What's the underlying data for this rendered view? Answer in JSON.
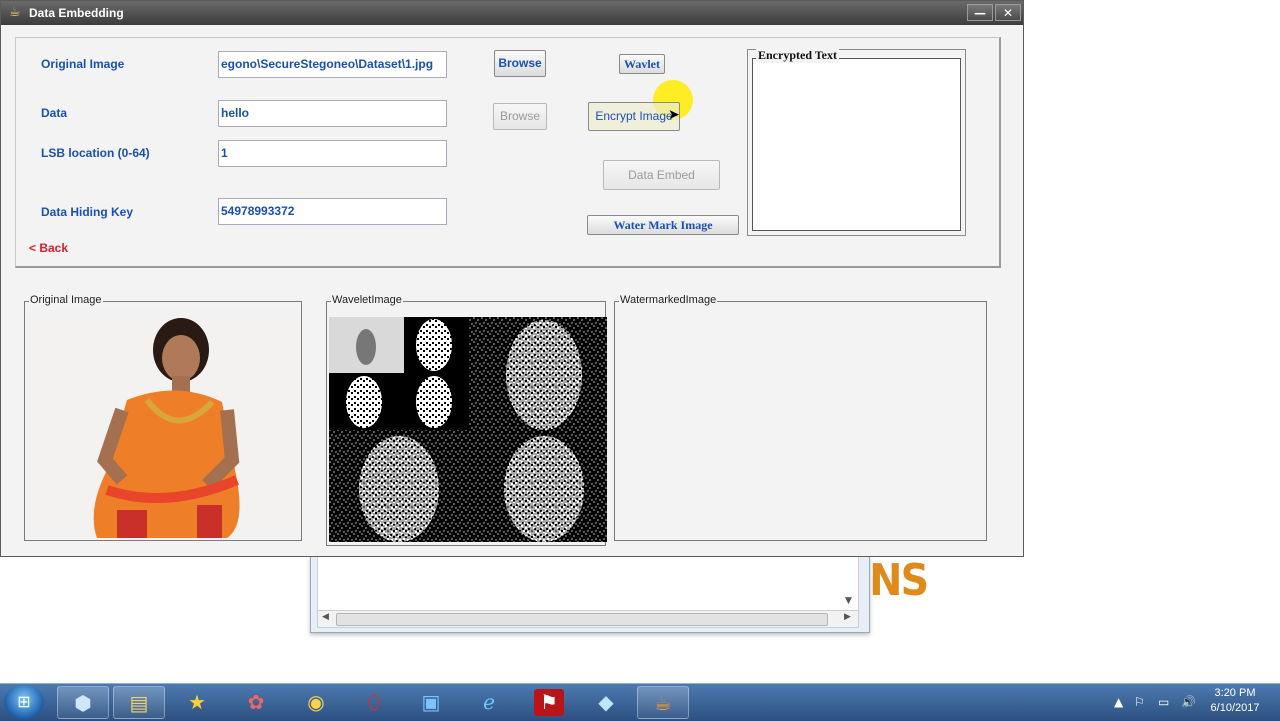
{
  "window": {
    "title": "Data Embedding",
    "min_label": "—",
    "close_label": "✕"
  },
  "form": {
    "original_image_label": "Original Image",
    "original_image_value": "egono\\SecureStegoneo\\Dataset\\1.jpg",
    "data_label": "Data",
    "data_value": "hello",
    "lsb_label": "LSB location (0-64)",
    "lsb_value": "1",
    "key_label": "Data Hiding Key",
    "key_value": "54978993372",
    "back_label": "< Back"
  },
  "buttons": {
    "browse1": "Browse",
    "browse2": "Browse",
    "wavelet": "Wavlet",
    "encrypt": "Encrypt Image",
    "data_embed": "Data Embed",
    "watermark": "Water Mark Image"
  },
  "encrypted_text": {
    "title": "Encrypted Text",
    "value": ""
  },
  "panels": {
    "original": "Original Image",
    "wavelet": "WaveletImage",
    "watermarked": "WatermarkedImage"
  },
  "background": {
    "fragment_text": "NS"
  },
  "taskbar": {
    "time": "3:20 PM",
    "date": "6/10/2017",
    "items": [
      "explorer-icon",
      "file-manager-icon",
      "app-star-icon",
      "app-mushroom-icon",
      "chrome-icon",
      "opera-icon",
      "image-viewer-icon",
      "ie-icon",
      "pdf-icon",
      "app-gem-icon",
      "java-icon"
    ]
  },
  "colors": {
    "label_blue": "#1a4fb4",
    "back_red": "#d81e2a",
    "titlebar": "#4a4a4a",
    "taskbar": "#3a6398"
  }
}
